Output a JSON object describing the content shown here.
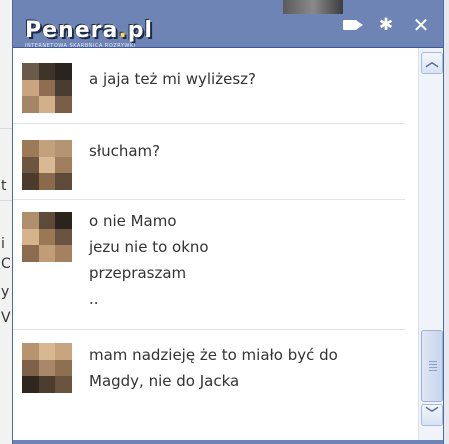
{
  "watermark": {
    "logo_main": "Penera",
    "logo_dot": ".",
    "logo_tld": "pl",
    "tagline": "INTERNETOWA SKARBNICA ROZRYWKI"
  },
  "titlebar": {
    "icons": [
      "video-icon",
      "gear-icon",
      "close-icon"
    ]
  },
  "background": {
    "left_fragments": [
      "t",
      "i",
      "C",
      "y",
      "V"
    ]
  },
  "messages": [
    {
      "lines": [
        "a jaja też mi wyliżesz?"
      ]
    },
    {
      "lines": [
        "słucham?"
      ]
    },
    {
      "lines": [
        "o nie Mamo",
        "jezu nie to okno",
        "przepraszam",
        ".."
      ]
    },
    {
      "lines": [
        "mam nadzieję że to miało być do",
        "Magdy, nie do Jacka"
      ]
    }
  ],
  "scrollbar": {
    "up_glyph": "︿",
    "down_glyph": "﹀"
  },
  "colors": {
    "titlebar": "#6d84b4",
    "border": "#3b5998",
    "text": "#333333"
  }
}
